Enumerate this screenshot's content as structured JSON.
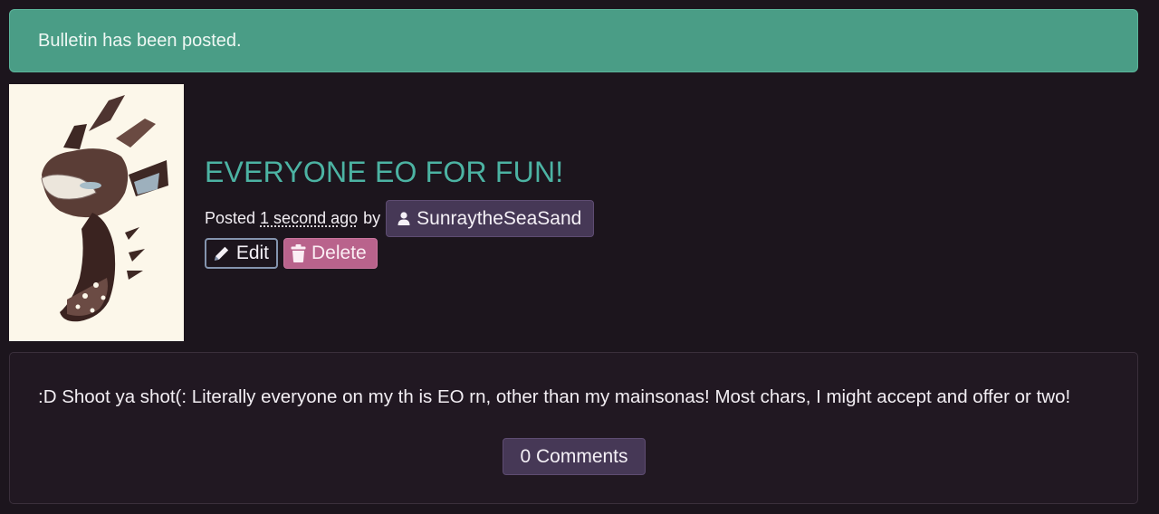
{
  "alert": {
    "message": "Bulletin has been posted."
  },
  "post": {
    "title": "EVERYONE EO FOR FUN!",
    "posted_prefix": "Posted",
    "posted_time": "1 second ago",
    "posted_by": "by",
    "author": "SunraytheSeaSand",
    "body": ":D Shoot ya shot(: Literally everyone on my th is EO rn, other than my mainsonas! Most chars, I might accept and offer or two!",
    "comments_label": "0 Comments"
  },
  "actions": {
    "edit_label": "Edit",
    "delete_label": "Delete"
  },
  "icons": {
    "user": "user-icon",
    "edit": "pencil-icon",
    "delete": "trash-icon"
  },
  "colors": {
    "background": "#1c151d",
    "alert": "#4a9d86",
    "title": "#4cb3a3",
    "badge": "#463856",
    "delete": "#b9638c"
  }
}
